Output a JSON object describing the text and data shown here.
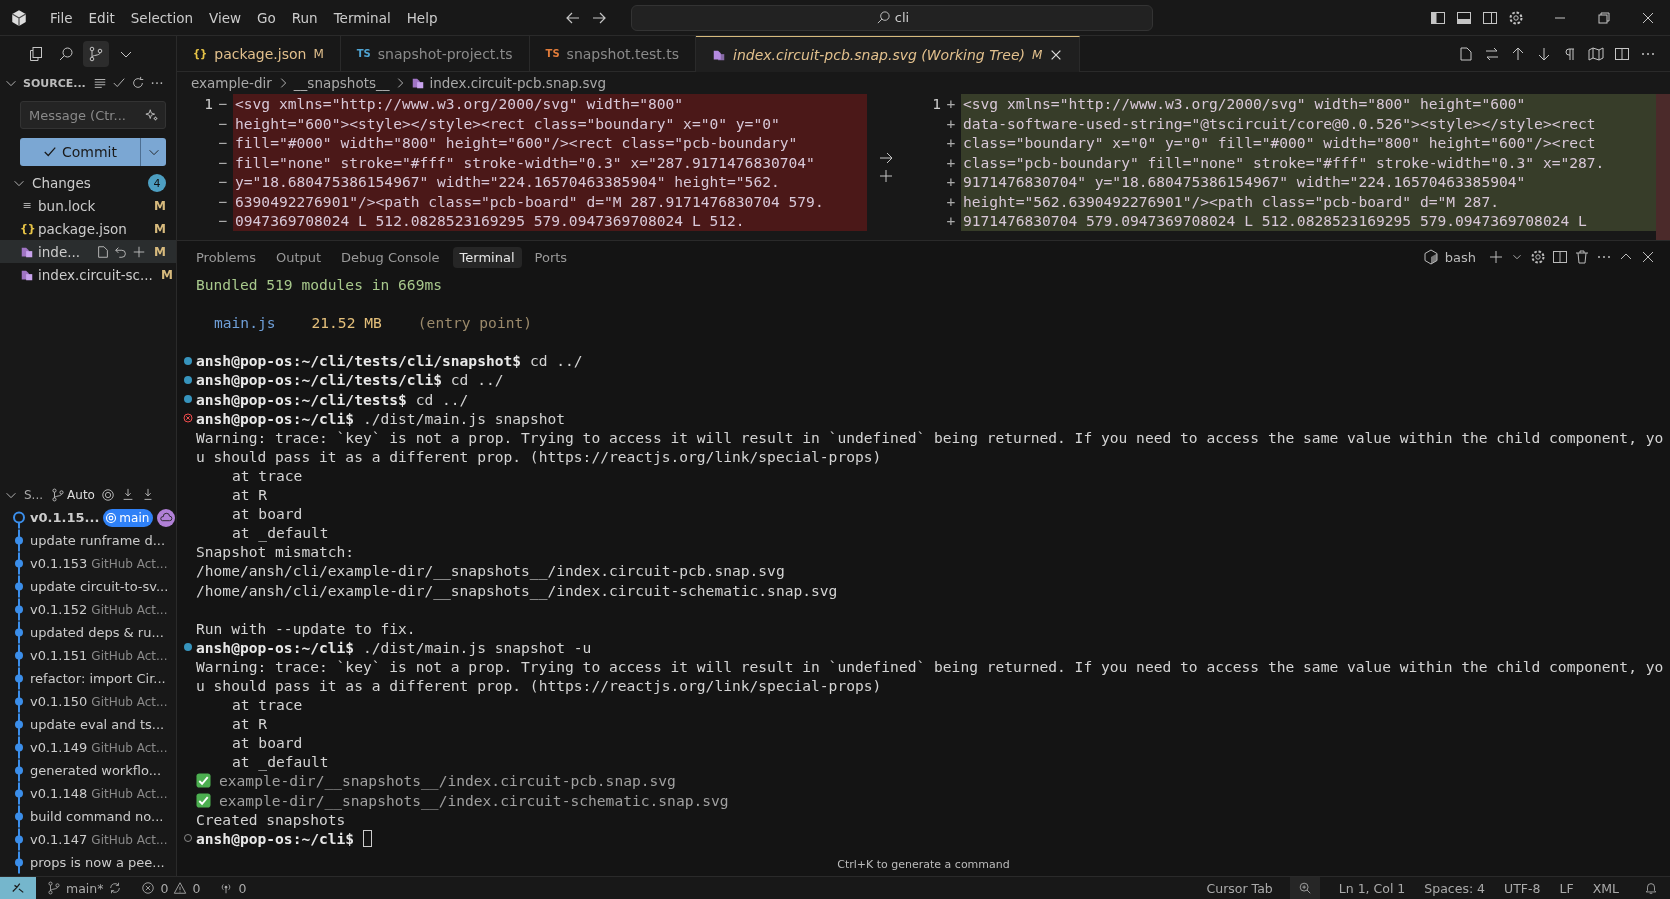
{
  "menu": [
    "File",
    "Edit",
    "Selection",
    "View",
    "Go",
    "Run",
    "Terminal",
    "Help"
  ],
  "search": {
    "value": "cli"
  },
  "sidebar": {
    "title": "SOURCE...",
    "message": {
      "placeholder": "Message (Ctr..."
    },
    "commit": {
      "label": "Commit"
    },
    "changes": {
      "label": "Changes",
      "count": "4",
      "expanded": true,
      "files": [
        {
          "icon": "≡",
          "kind": "text",
          "name": "bun.lock",
          "status": "M",
          "selected": false
        },
        {
          "icon": "{}",
          "kind": "json",
          "name": "package.json",
          "status": "M",
          "selected": false
        },
        {
          "kind": "svg",
          "name": "inde...",
          "status": "M",
          "selected": true
        },
        {
          "kind": "svg",
          "name": "index.circuit-sc...",
          "status": "M",
          "selected": false
        }
      ]
    },
    "graph": {
      "title": "S...",
      "mode": "Auto",
      "items": [
        {
          "message": "v0.1.15...",
          "current": true,
          "branch": "main"
        },
        {
          "message": "update runframe d...",
          "current": false
        },
        {
          "message": "v0.1.153",
          "author": "GitHub Act...",
          "current": false
        },
        {
          "message": "update circuit-to-sv...",
          "current": false
        },
        {
          "message": "v0.1.152",
          "author": "GitHub Act...",
          "current": false
        },
        {
          "message": "updated deps & ru...",
          "current": false
        },
        {
          "message": "v0.1.151",
          "author": "GitHub Act...",
          "current": false
        },
        {
          "message": "refactor: import Cir...",
          "current": false
        },
        {
          "message": "v0.1.150",
          "author": "GitHub Act...",
          "current": false
        },
        {
          "message": "update eval and ts...",
          "current": false
        },
        {
          "message": "v0.1.149",
          "author": "GitHub Act...",
          "current": false
        },
        {
          "message": "generated workflo...",
          "current": false
        },
        {
          "message": "v0.1.148",
          "author": "GitHub Act...",
          "current": false
        },
        {
          "message": "build command no...",
          "current": false
        },
        {
          "message": "v0.1.147",
          "author": "GitHub Act...",
          "current": false
        },
        {
          "message": "props is now a pee...",
          "current": false
        }
      ]
    }
  },
  "tabs": [
    {
      "icon": "{}",
      "kind": "json",
      "label": "package.json",
      "status": "M",
      "selected": false,
      "color": "#e8c547"
    },
    {
      "icon": "TS",
      "kind": "ts",
      "label": "snapshot-project.ts",
      "selected": false,
      "color": "#4fa3d1"
    },
    {
      "icon": "TS",
      "kind": "ts",
      "label": "snapshot.test.ts",
      "selected": false,
      "color": "#e07b3a"
    },
    {
      "kind": "svg",
      "label": "index.circuit-pcb.snap.svg (Working Tree)",
      "status": "M",
      "selected": true,
      "color": "#b48ae0"
    }
  ],
  "breadcrumbs": [
    "example-dir",
    "__snapshots__",
    "index.circuit-pcb.snap.svg"
  ],
  "diff": {
    "left": [
      {
        "number": "1",
        "marker": "−",
        "text": "<svg xmlns=\"http://www.w3.org/2000/svg\" width=\"800\""
      },
      {
        "marker": "−",
        "text": "height=\"600\"><style></style><rect class=\"boundary\" x=\"0\" y=\"0\""
      },
      {
        "marker": "−",
        "text": "fill=\"#000\" width=\"800\" height=\"600\"/><rect class=\"pcb-boundary\""
      },
      {
        "marker": "−",
        "text": "fill=\"none\" stroke=\"#fff\" stroke-width=\"0.3\" x=\"287.9171476830704\""
      },
      {
        "marker": "−",
        "text": "y=\"18.680475386154967\" width=\"224.16570463385904\" height=\"562."
      },
      {
        "marker": "−",
        "text": "6390492276901\"/><path class=\"pcb-board\" d=\"M 287.9171476830704 579."
      },
      {
        "marker": "−",
        "text": "0947369708024 L 512.0828523169295 579.0947369708024 L 512."
      }
    ],
    "right": [
      {
        "number": "1",
        "marker": "+",
        "text": "<svg xmlns=\"http://www.w3.org/2000/svg\" width=\"800\" height=\"600\""
      },
      {
        "marker": "+",
        "text": "data-software-used-string=\"@tscircuit/core@0.0.526\"><style></style><rect"
      },
      {
        "marker": "+",
        "text": "class=\"boundary\" x=\"0\" y=\"0\" fill=\"#000\" width=\"800\" height=\"600\"/><rect"
      },
      {
        "marker": "+",
        "text": "class=\"pcb-boundary\" fill=\"none\" stroke=\"#fff\" stroke-width=\"0.3\" x=\"287."
      },
      {
        "marker": "+",
        "text": "9171476830704\" y=\"18.680475386154967\" width=\"224.16570463385904\""
      },
      {
        "marker": "+",
        "text": "height=\"562.6390492276901\"/><path class=\"pcb-board\" d=\"M 287."
      },
      {
        "marker": "+",
        "text": "9171476830704 579.0947369708024 L 512.0828523169295 579.0947369708024 L"
      }
    ]
  },
  "panel": {
    "tabs": [
      {
        "label": "Problems",
        "selected": false
      },
      {
        "label": "Output",
        "selected": false
      },
      {
        "label": "Debug Console",
        "selected": false
      },
      {
        "label": "Terminal",
        "selected": true
      },
      {
        "label": "Ports",
        "selected": false
      }
    ],
    "shell": "bash"
  },
  "terminal": {
    "lines": [
      {
        "kind": "success",
        "text": "Bundled 519 modules in 669ms"
      },
      {
        "kind": "blank"
      },
      {
        "kind": "bundle",
        "file": "main.js",
        "size": "21.52 MB",
        "note": "(entry point)"
      },
      {
        "kind": "blank"
      },
      {
        "kind": "prompt",
        "failed": false,
        "active": false,
        "prompt": "ansh@pop-os:~/cli/tests/cli/snapshot$",
        "command": " cd ../"
      },
      {
        "kind": "prompt",
        "failed": false,
        "active": false,
        "prompt": "ansh@pop-os:~/cli/tests/cli$",
        "command": " cd ../"
      },
      {
        "kind": "prompt",
        "failed": false,
        "active": false,
        "prompt": "ansh@pop-os:~/cli/tests$",
        "command": " cd ../"
      },
      {
        "kind": "prompt",
        "failed": true,
        "active": false,
        "prompt": "ansh@pop-os:~/cli$",
        "command": " ./dist/main.js snapshot"
      },
      {
        "kind": "output",
        "text": "Warning: trace: `key` is not a prop. Trying to access it will result in `undefined` being returned. If you need to access the same value within the child component, yo"
      },
      {
        "kind": "output",
        "text": "u should pass it as a different prop. (https://reactjs.org/link/special-props)"
      },
      {
        "kind": "stack",
        "text": "at trace"
      },
      {
        "kind": "stack",
        "text": "at R"
      },
      {
        "kind": "stack",
        "text": "at board"
      },
      {
        "kind": "stack",
        "text": "at _default"
      },
      {
        "kind": "output",
        "text": "Snapshot mismatch:"
      },
      {
        "kind": "output",
        "text": "/home/ansh/cli/example-dir/__snapshots__/index.circuit-pcb.snap.svg"
      },
      {
        "kind": "output",
        "text": "/home/ansh/cli/example-dir/__snapshots__/index.circuit-schematic.snap.svg"
      },
      {
        "kind": "blank"
      },
      {
        "kind": "output",
        "text": "Run with --update to fix."
      },
      {
        "kind": "prompt",
        "failed": false,
        "active": false,
        "prompt": "ansh@pop-os:~/cli$",
        "command": " ./dist/main.js snapshot -u"
      },
      {
        "kind": "output",
        "text": "Warning: trace: `key` is not a prop. Trying to access it will result in `undefined` being returned. If you need to access the same value within the child component, yo"
      },
      {
        "kind": "output",
        "text": "u should pass it as a different prop. (https://reactjs.org/link/special-props)"
      },
      {
        "kind": "stack",
        "text": "at trace"
      },
      {
        "kind": "stack",
        "text": "at R"
      },
      {
        "kind": "stack",
        "text": "at board"
      },
      {
        "kind": "stack",
        "text": "at _default"
      },
      {
        "kind": "check",
        "text": "example-dir/__snapshots__/index.circuit-pcb.snap.svg"
      },
      {
        "kind": "check",
        "text": "example-dir/__snapshots__/index.circuit-schematic.snap.svg"
      },
      {
        "kind": "output",
        "text": "Created snapshots"
      },
      {
        "kind": "prompt",
        "failed": false,
        "active": true,
        "prompt": "ansh@pop-os:~/cli$"
      }
    ],
    "hint": "Ctrl+K to generate a command"
  },
  "status_bar": {
    "branch": "main*",
    "errors": "0",
    "warnings": "0",
    "ports": "0",
    "right": [
      "Cursor Tab",
      "Ln 1, Col 1",
      "Spaces: 4",
      "UTF-8",
      "LF",
      "XML"
    ]
  }
}
